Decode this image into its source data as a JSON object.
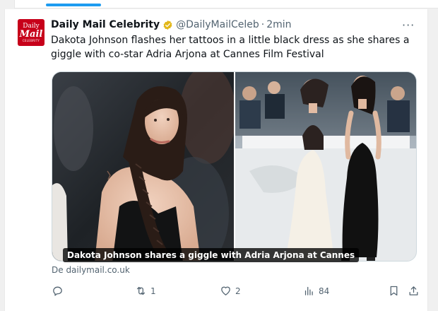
{
  "tweet": {
    "avatar": {
      "line1": "Daily",
      "line2": "Mail",
      "line3": "CELEBRITY"
    },
    "author_name": "Daily Mail Celebrity",
    "handle": "@DailyMailCeleb",
    "separator": "·",
    "time": "2min",
    "more": "···",
    "text": "Dakota Johnson flashes her tattoos in a little black dress as she shares a giggle with co-star Adria Arjona at Cannes Film Festival",
    "media_caption": "Dakota Johnson shares a giggle with Adria Arjona at Cannes",
    "source": "De dailymail.co.uk",
    "actions": {
      "reply": {
        "icon": "reply-icon",
        "count": ""
      },
      "retweet": {
        "icon": "retweet-icon",
        "count": "1"
      },
      "like": {
        "icon": "heart-icon",
        "count": "2"
      },
      "views": {
        "icon": "views-icon",
        "count": "84"
      },
      "bookmark": {
        "icon": "bookmark-icon"
      },
      "share": {
        "icon": "share-icon"
      }
    }
  },
  "colors": {
    "accent": "#1d9bf0",
    "avatar_bg": "#c7001a",
    "badge": "#e2b719",
    "muted": "#536471"
  }
}
